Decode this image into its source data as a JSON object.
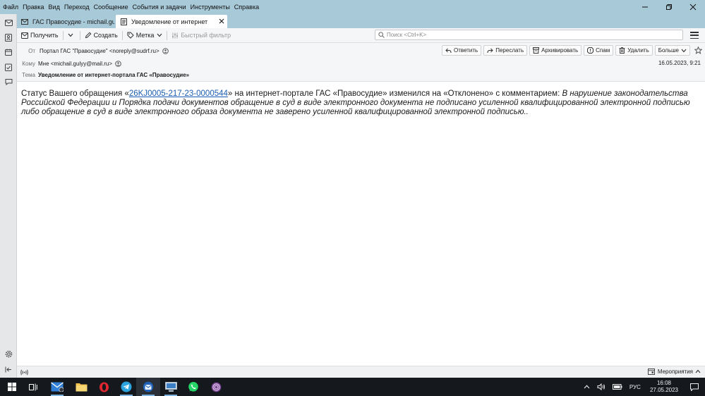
{
  "menu": [
    "Файл",
    "Правка",
    "Вид",
    "Переход",
    "Сообщение",
    "События и задачи",
    "Инструменты",
    "Справка"
  ],
  "tabs": [
    {
      "label": "ГАС Правосудие - michail.guly",
      "active": false
    },
    {
      "label": "Уведомление от интернет",
      "active": true
    }
  ],
  "toolbar": {
    "get_label": "Получить",
    "create_label": "Создать",
    "tag_label": "Метка",
    "quick_filter_label": "Быстрый фильтр",
    "search_placeholder": "Поиск <Ctrl+K>"
  },
  "header": {
    "from_label": "От",
    "from_value": "Портал ГАС \"Правосудие\" <noreply@sudrf.ru>",
    "to_label": "Кому",
    "to_value": "Мне <michail.gulyy@mail.ru>",
    "subject_label": "Тема",
    "subject_value": "Уведомление от интернет-портала ГАС «Правосудие»",
    "date": "16.05.2023, 9:21",
    "actions": {
      "reply": "Ответить",
      "forward": "Переслать",
      "archive": "Архивировать",
      "spam": "Спам",
      "delete": "Удалить",
      "more": "Больше"
    }
  },
  "body": {
    "prefix": "Статус Вашего обращения «",
    "link": "26KJ0005-217-23-0000544",
    "middle": "» на интернет-портале ГАС «Правосудие» изменился на «Отклонено» с комментарием: ",
    "comment": "В нарушение законодательства Российской Федерации и Порядка подачи документов обращение в суд в виде электронного документа не подписано усиленной квалифицированной электронной подписью либо обращение в суд в виде электронного образа документа не заверено усиленной квалифицированной электронной подписью.."
  },
  "statusbar": {
    "events_label": "Мероприятия"
  },
  "taskbar": {
    "apps": [
      "windows-start",
      "task-view",
      "mail",
      "file-explorer",
      "opera",
      "telegram",
      "thunderbird",
      "network-manager",
      "whatsapp",
      "tor-browser"
    ],
    "language": "РУС",
    "time": "16:08",
    "date": "27.05.2023"
  },
  "colors": {
    "accent_bar": "#a8c9d8",
    "link": "#1a5cb0",
    "taskbar": "#15181d"
  }
}
